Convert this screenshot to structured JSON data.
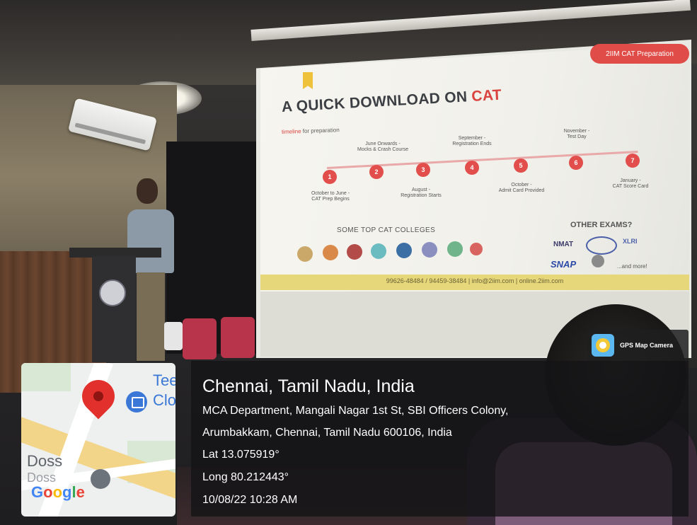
{
  "slide": {
    "pill": "2IIM  CAT Preparation",
    "title_main": "A QUICK DOWNLOAD ON ",
    "title_accent": "CAT",
    "subtitle_accent": "timeline",
    "subtitle_rest": " for preparation",
    "steps": [
      "1",
      "2",
      "3",
      "4",
      "5",
      "6",
      "7"
    ],
    "step_labels": {
      "s1": "October to June -\nCAT Prep Begins",
      "s2": "June Onwards -\nMocks & Crash Course",
      "s3": "August -\nRegistration Starts",
      "s4": "September -\nRegistration Ends",
      "s5": "October -\nAdmit Card Provided",
      "s6": "November -\nTest Day",
      "s7": "January -\nCAT Score Card"
    },
    "colleges_heading": "SOME TOP CAT COLLEGES",
    "exams_heading": "OTHER EXAMS?",
    "exams": {
      "nmat": "NMAT",
      "snap": "SNAP",
      "xlri": "XLRI",
      "more": "...and more!"
    },
    "footer": "99626-48484 / 94459-38484 | info@2iim.com | online.2iim.com"
  },
  "gps": {
    "app_name": "GPS Map Camera",
    "location_title": "Chennai, Tamil Nadu, India",
    "address_line1": "MCA Department, Mangali Nagar 1st St, SBI Officers Colony,",
    "address_line2": "Arumbakkam, Chennai, Tamil Nadu 600106, India",
    "lat": "Lat 13.075919°",
    "long": "Long 80.212443°",
    "datetime": "10/08/22 10:28 AM"
  },
  "map": {
    "label_top": "Tee",
    "label_top2": "Clo",
    "label_bottom": "Doss",
    "label_bottom2": "Doss",
    "google_letters": [
      "G",
      "o",
      "o",
      "g",
      "l",
      "e"
    ]
  },
  "colors": {
    "slide_red": "#e14e4b",
    "pin_red": "#e2302c",
    "map_road": "#f3d58a",
    "footer_band": "#e6d77a"
  }
}
